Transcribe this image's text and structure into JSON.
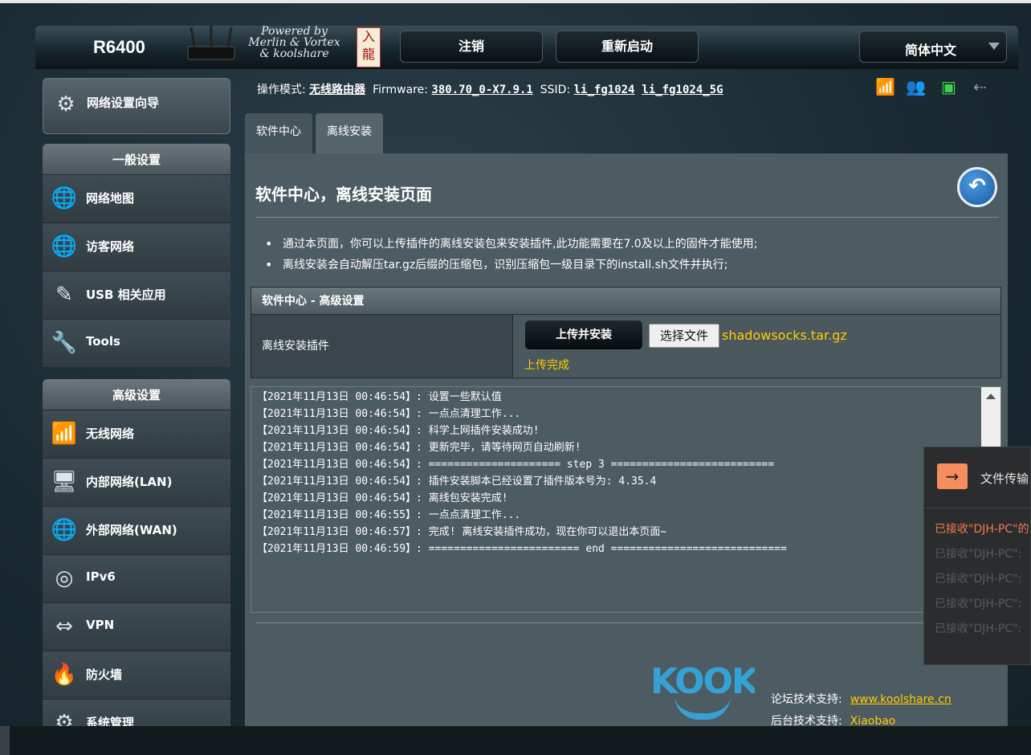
{
  "header": {
    "model": "R6400",
    "powered_by": "Powered by",
    "powered_line2": "Merlin & Vortex",
    "powered_line3": "& koolshare",
    "logout": "注销",
    "reboot": "重新启动",
    "language": "简体中文"
  },
  "sidebar": {
    "wizard": "网络设置向导",
    "general_title": "一般设置",
    "general_items": [
      "网络地图",
      "访客网络",
      "USB 相关应用",
      "Tools"
    ],
    "advanced_title": "高级设置",
    "advanced_items": [
      "无线网络",
      "内部网络(LAN)",
      "外部网络(WAN)",
      "IPv6",
      "VPN",
      "防火墙",
      "系统管理"
    ]
  },
  "status": {
    "mode_label": "操作模式:",
    "mode_value": "无线路由器",
    "firmware_label": "Firmware:",
    "firmware_value": "380.70_0-X7.9.1",
    "ssid_label": "SSID:",
    "ssid_1": "li_fg1024",
    "ssid_2": "li_fg1024_5G"
  },
  "tabs": [
    "软件中心",
    "离线安装"
  ],
  "page": {
    "title": "软件中心，离线安装页面",
    "notes": [
      "通过本页面，你可以上传插件的离线安装包来安装插件,此功能需要在7.0及以上的固件才能使用;",
      "离线安装会自动解压tar.gz后缀的压缩包，识别压缩包一级目录下的install.sh文件并执行;"
    ],
    "table_header": "软件中心 - 高级设置",
    "row_label": "离线安装插件",
    "upload_button": "上传并安装",
    "choose_file": "选择文件",
    "file_name": "shadowsocks.tar.gz",
    "upload_status": "上传完成"
  },
  "log": [
    "【2021年11月13日 00:46:54】: 设置一些默认值",
    "【2021年11月13日 00:46:54】: 一点点清理工作...",
    "【2021年11月13日 00:46:54】: 科学上网插件安装成功!",
    "【2021年11月13日 00:46:54】: 更新完毕，请等待网页自动刷新!",
    "【2021年11月13日 00:46:54】: ===================== step 3 ==========================",
    "【2021年11月13日 00:46:54】: 插件安装脚本已经设置了插件版本号为: 4.35.4",
    "【2021年11月13日 00:46:54】: 离线包安装完成!",
    "【2021年11月13日 00:46:55】: 一点点清理工作...",
    "【2021年11月13日 00:46:57】: 完成! 离线安装插件成功，现在你可以退出本页面~",
    "【2021年11月13日 00:46:59】: ======================== end ============================"
  ],
  "footer": {
    "forum_label": "论坛技术支持:",
    "forum_link": "www.koolshare.cn",
    "backend_label": "后台技术支持:",
    "backend_value": "Xiaobao"
  },
  "popup": {
    "title": "文件传输",
    "messages": [
      "已接收\"DJH-PC\"的",
      "已接收\"DJH-PC\":",
      "已接收\"DJH-PC\":",
      "已接收\"DJH-PC\":",
      "已接收\"DJH-PC\":"
    ]
  },
  "colors": {
    "accent_yellow": "#ffcc00",
    "popup_orange": "#f07c4c",
    "logo_blue": "#33a3d6"
  }
}
